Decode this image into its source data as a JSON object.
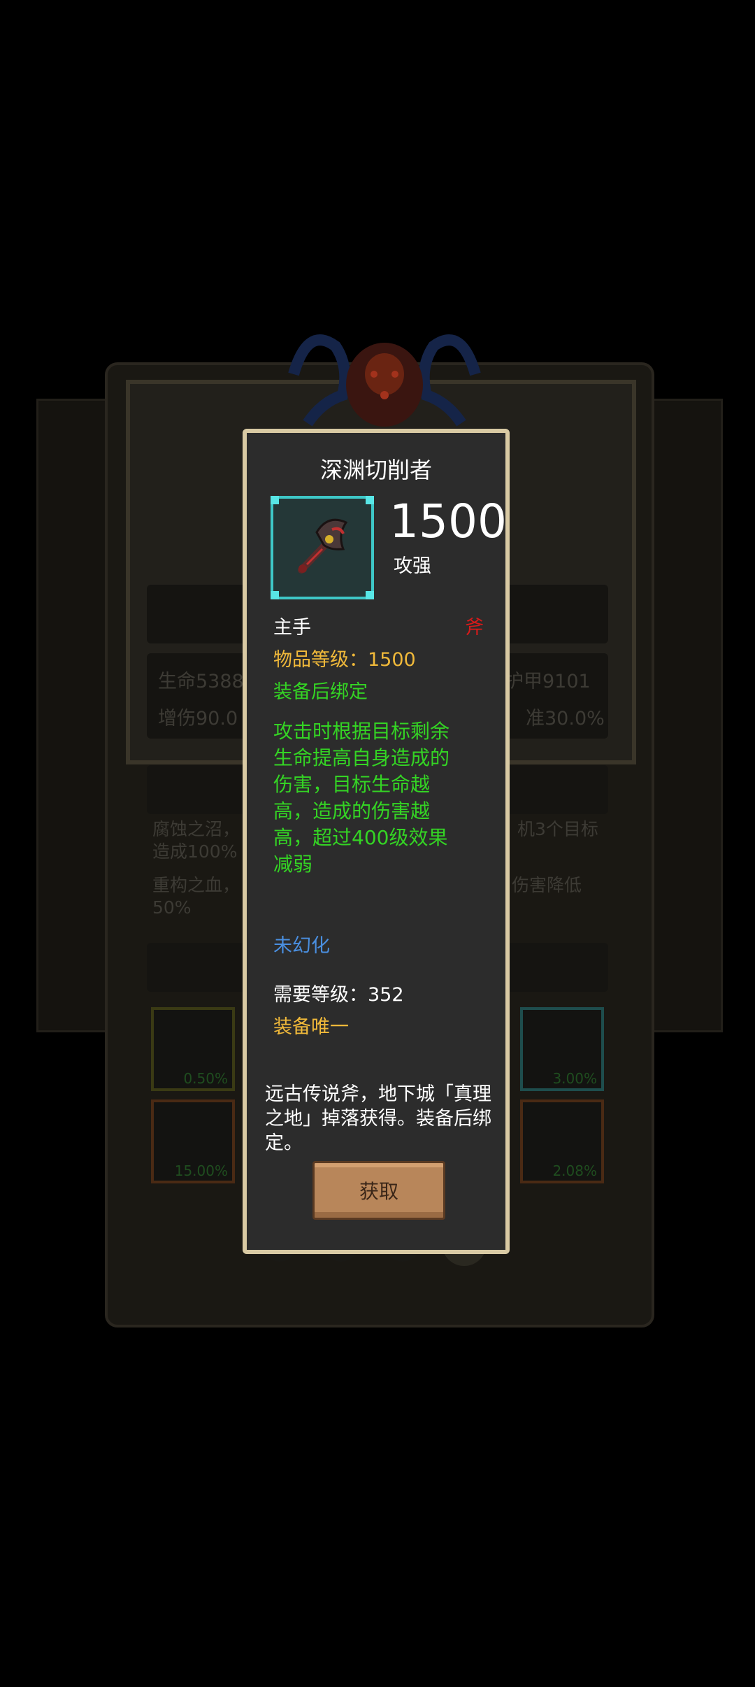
{
  "tooltip": {
    "title": "深渊切削者",
    "power_value": "1500",
    "power_label": "攻强",
    "slot": "主手",
    "weapon_type": "斧",
    "item_level": "物品等级：1500",
    "bind_rule": "装备后绑定",
    "effect": "攻击时根据目标剩余生命提高自身造成的伤害，目标生命越高，造成的伤害越高，超过400级效果减弱",
    "illusion_status": "未幻化",
    "required_level": "需要等级：352",
    "unique": "装备唯一",
    "lore": "远古传说斧，地下城「真理之地」掉落获得。装备后绑定。",
    "get_button": "获取",
    "item_icon": "axe-icon"
  },
  "background": {
    "stats": [
      "生命5388",
      "增伤90.0",
      "护甲9101",
      "准30.0%"
    ],
    "desc_lines": [
      "腐蚀之沼，",
      "机3个目标",
      "造成100%",
      "重构之血，",
      "伤害降低",
      "50%"
    ],
    "slot_percents": [
      "0.50%",
      "3.00%",
      "15.00%",
      "2.08%"
    ]
  },
  "colors": {
    "tooltip_bg": "#2c2c2c",
    "tooltip_border": "#d9caa4",
    "gold": "#f0b93a",
    "green": "#34d424",
    "blue": "#4a8fe0",
    "red": "#d81a1a",
    "icon_frame": "#3ec7c7"
  }
}
